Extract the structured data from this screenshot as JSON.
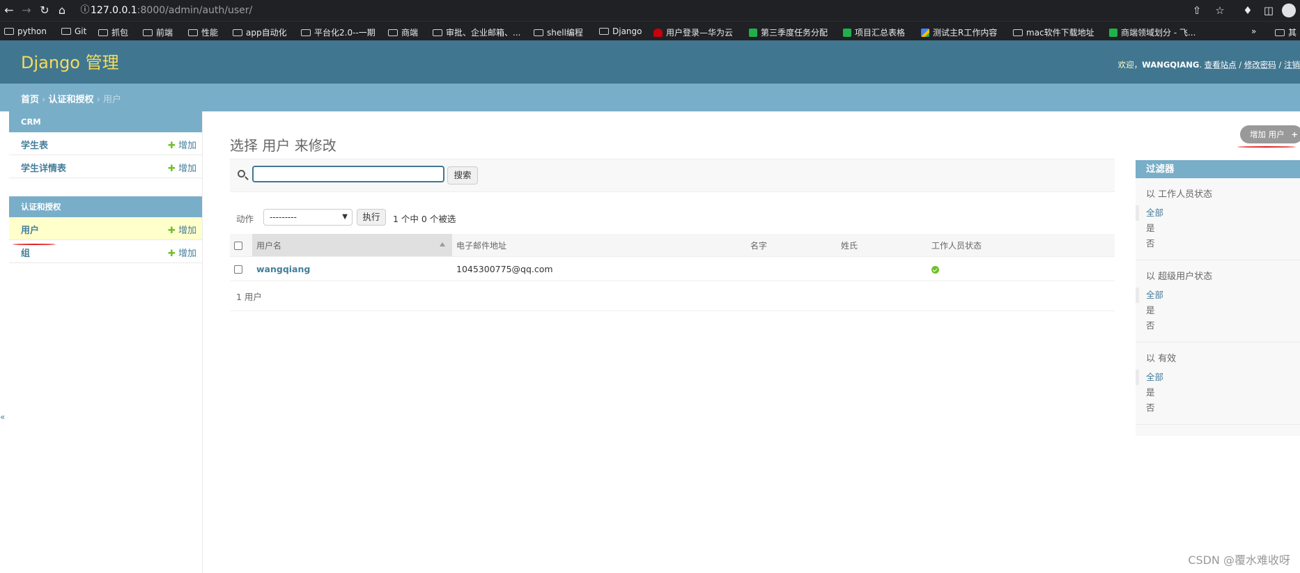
{
  "browser": {
    "url_host": "127.0.0.1",
    "url_rest": ":8000/admin/auth/user/",
    "bookmarks": [
      {
        "label": "python",
        "icon": "folder-icon"
      },
      {
        "label": "Git",
        "icon": "folder-icon"
      },
      {
        "label": "抓包",
        "icon": "folder-icon"
      },
      {
        "label": "前端",
        "icon": "folder-icon"
      },
      {
        "label": "性能",
        "icon": "folder-icon"
      },
      {
        "label": "app自动化",
        "icon": "folder-icon"
      },
      {
        "label": "平台化2.0--一期",
        "icon": "folder-icon"
      },
      {
        "label": "商端",
        "icon": "folder-icon"
      },
      {
        "label": "审批、企业邮箱、...",
        "icon": "folder-icon"
      },
      {
        "label": "shell编程",
        "icon": "folder-icon"
      },
      {
        "label": "Django",
        "icon": "folder-icon"
      },
      {
        "label": "用户登录—华为云",
        "icon": "huawei-icon"
      },
      {
        "label": "第三季度任务分配",
        "icon": "sheet-icon"
      },
      {
        "label": "项目汇总表格",
        "icon": "sheet-icon"
      },
      {
        "label": "测试主R工作内容",
        "icon": "google-icon"
      },
      {
        "label": "mac软件下载地址",
        "icon": "folder-icon"
      },
      {
        "label": "商端领域划分 - 飞...",
        "icon": "sheet-icon"
      }
    ],
    "more": "»",
    "other_bookmarks": "其"
  },
  "header": {
    "brand": "Django 管理",
    "welcome": "欢迎，",
    "username": "WANGQIANG",
    "view_site": "查看站点",
    "change_password": "修改密码",
    "logout": "注销"
  },
  "breadcrumbs": {
    "home": "首页",
    "app": "认证和授权",
    "current": "用户"
  },
  "sidebar": {
    "crm_caption": "CRM",
    "crm_items": [
      {
        "label": "学生表",
        "add": "增加"
      },
      {
        "label": "学生详情表",
        "add": "增加"
      }
    ],
    "auth_caption": "认证和授权",
    "auth_items": [
      {
        "label": "用户",
        "add": "增加"
      },
      {
        "label": "组",
        "add": "增加"
      }
    ]
  },
  "content": {
    "title": "选择 用户 来修改",
    "add_button": "增加 用户",
    "search_value": "",
    "search_button": "搜索",
    "action_label": "动作",
    "action_selected": "---------",
    "go_button": "执行",
    "selection_counter": "1 个中 0 个被选",
    "columns": [
      "用户名",
      "电子邮件地址",
      "名字",
      "姓氏",
      "工作人员状态"
    ],
    "rows": [
      {
        "username": "wangqiang",
        "email": "1045300775@qq.com",
        "first_name": "",
        "last_name": "",
        "is_staff": true
      }
    ],
    "paginator": "1 用户"
  },
  "filter": {
    "title": "过滤器",
    "groups": [
      {
        "title": "以 工作人员状态",
        "options": [
          "全部",
          "是",
          "否"
        ]
      },
      {
        "title": "以 超级用户状态",
        "options": [
          "全部",
          "是",
          "否"
        ]
      },
      {
        "title": "以 有效",
        "options": [
          "全部",
          "是",
          "否"
        ]
      }
    ]
  },
  "edge_mark": "«",
  "watermark": "CSDN @覆水难收呀",
  "colors": {
    "header": "#417690",
    "breadcrumbs": "#79aec8",
    "brand": "#f5dd5d",
    "link": "#447e9b",
    "add_plus": "#70bf2b",
    "annotation": "#e02020"
  }
}
